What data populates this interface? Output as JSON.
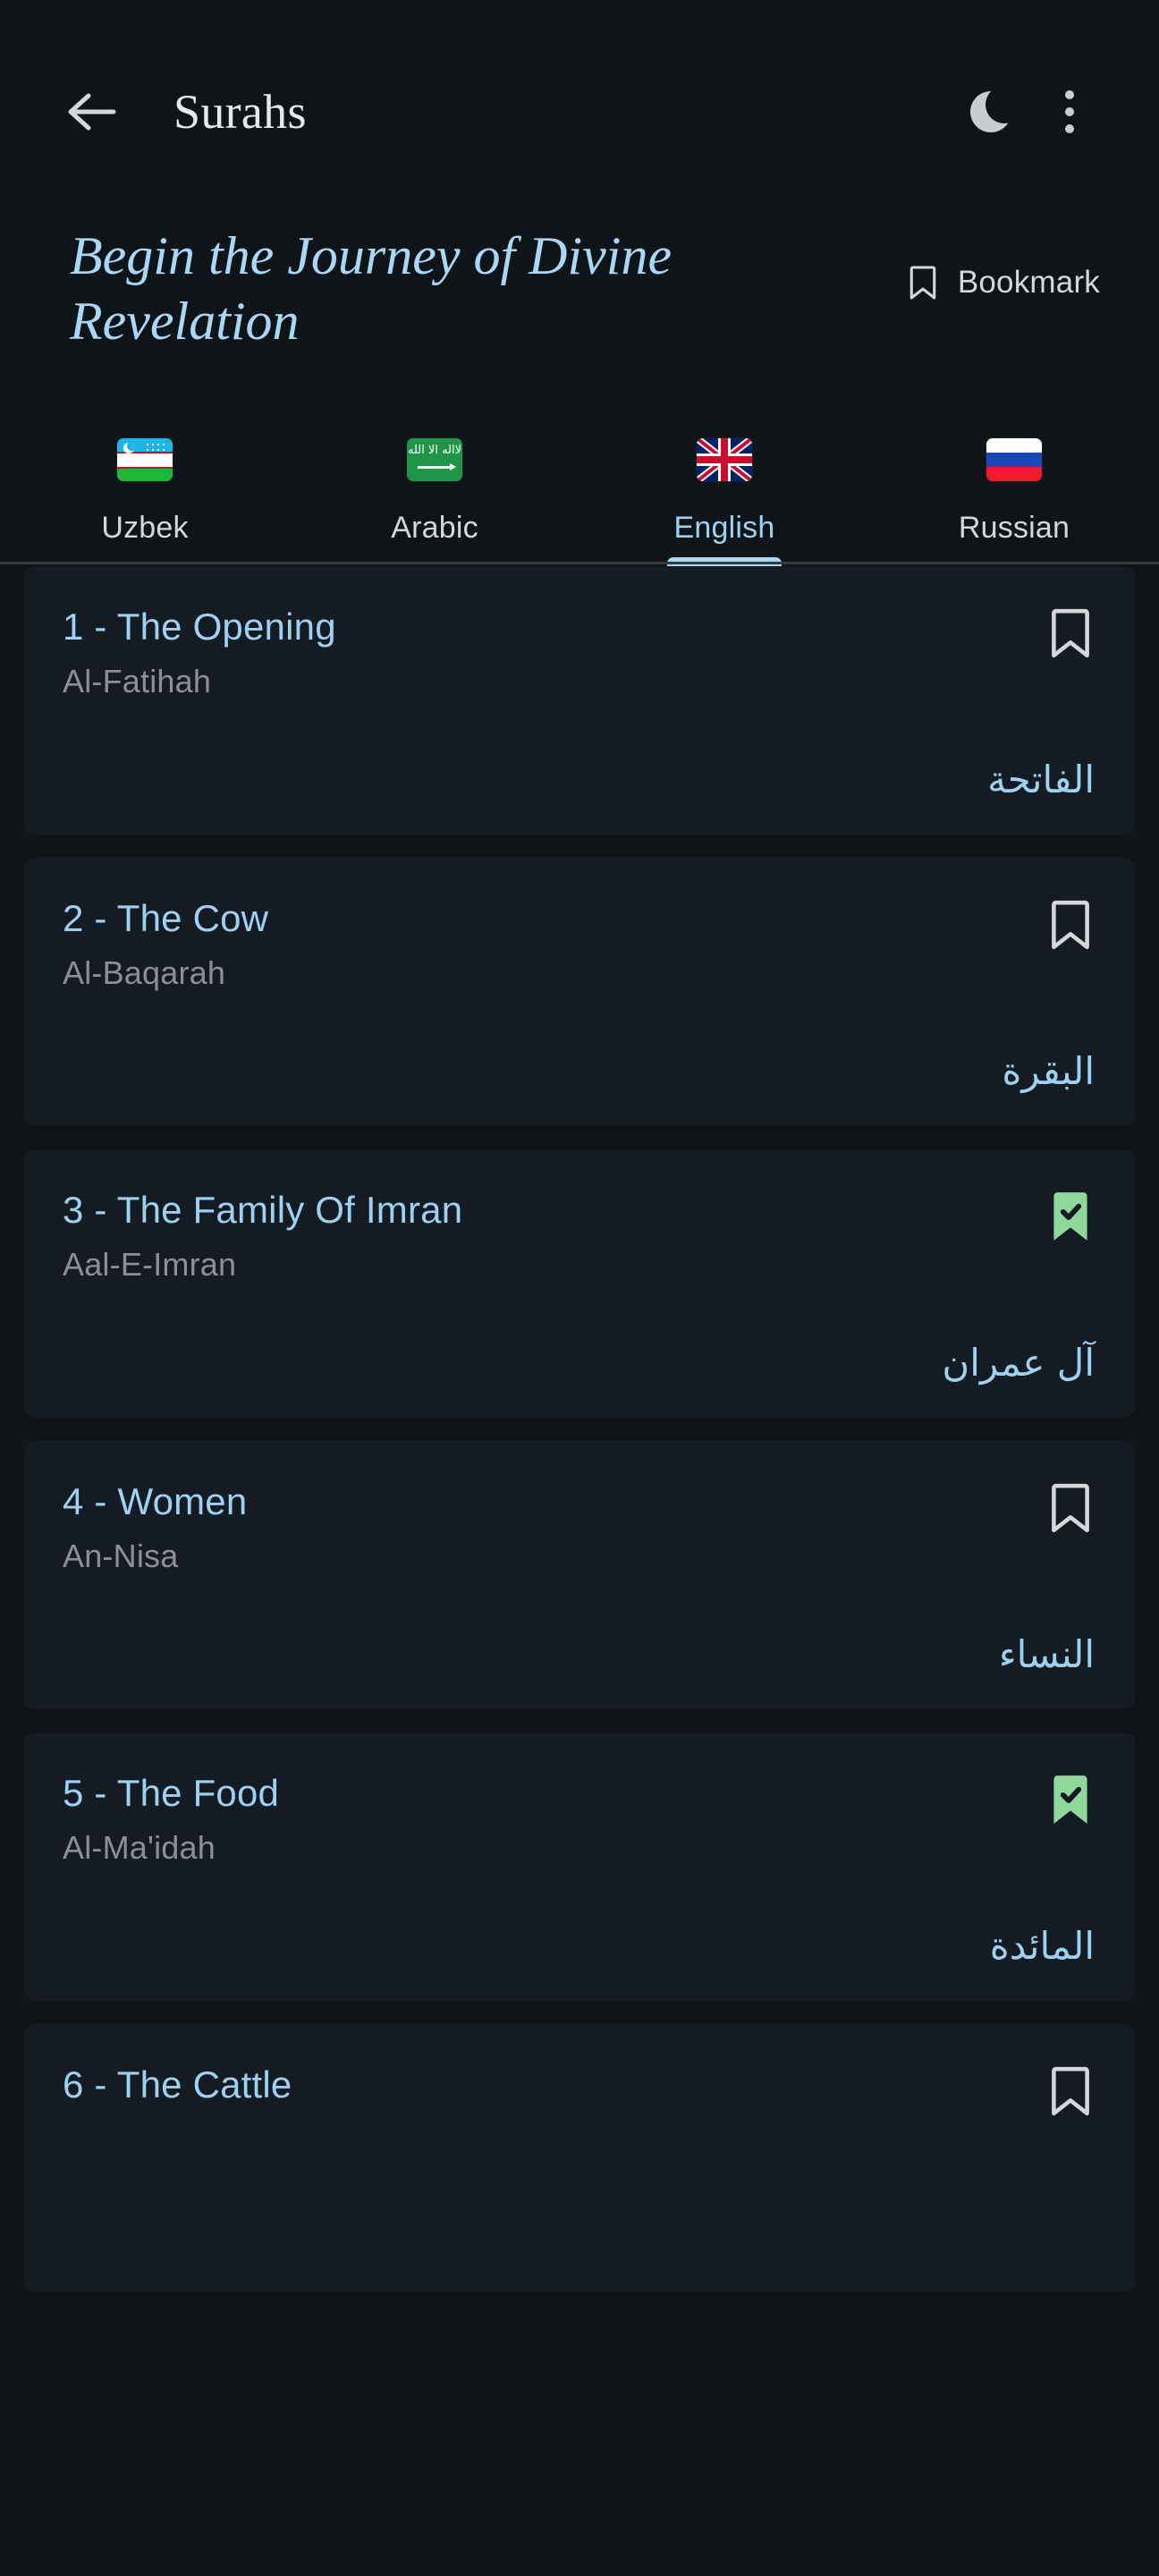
{
  "appbar": {
    "back_icon": "arrow-left-icon",
    "title": "Surahs",
    "theme_toggle_icon": "moon-icon",
    "overflow_icon": "more-vertical-icon"
  },
  "hero": {
    "title": "Begin the Journey of Divine Revelation",
    "bookmark_label": "Bookmark",
    "bookmark_icon": "bookmark-outline-icon"
  },
  "tabs": {
    "selected": "English",
    "items": [
      {
        "label": "Uzbek",
        "flag": "flag-uzbekistan",
        "active": false
      },
      {
        "label": "Arabic",
        "flag": "flag-saudi-arabia",
        "active": false
      },
      {
        "label": "English",
        "flag": "flag-united-kingdom",
        "active": true
      },
      {
        "label": "Russian",
        "flag": "flag-russia",
        "active": false
      }
    ]
  },
  "colors": {
    "page_background": "#0f1419",
    "card_background": "#151b22",
    "accent_blue": "#9ed0f0",
    "hero_blue": "#a9d7f5",
    "muted_text": "#8b9096",
    "bookmark_saved_green": "#8fd79b",
    "divider": "#343a41"
  },
  "surahs": [
    {
      "title": "1 - The Opening",
      "transliteration": "Al-Fatihah",
      "arabic": "الفاتحة",
      "bookmarked": false,
      "bookmark_icon": "bookmark-outline-icon"
    },
    {
      "title": "2 - The Cow",
      "transliteration": "Al-Baqarah",
      "arabic": "البقرة",
      "bookmarked": false,
      "bookmark_icon": "bookmark-outline-icon"
    },
    {
      "title": "3 - The Family Of Imran",
      "transliteration": "Aal-E-Imran",
      "arabic": "آل عمران",
      "bookmarked": true,
      "bookmark_icon": "bookmark-check-filled-icon"
    },
    {
      "title": "4 - Women",
      "transliteration": "An-Nisa",
      "arabic": "النساء",
      "bookmarked": false,
      "bookmark_icon": "bookmark-outline-icon"
    },
    {
      "title": "5 - The Food",
      "transliteration": "Al-Ma'idah",
      "arabic": "المائدة",
      "bookmarked": true,
      "bookmark_icon": "bookmark-check-filled-icon"
    },
    {
      "title": "6 - The Cattle",
      "transliteration": "",
      "arabic": "",
      "bookmarked": false,
      "bookmark_icon": "bookmark-outline-icon"
    }
  ]
}
